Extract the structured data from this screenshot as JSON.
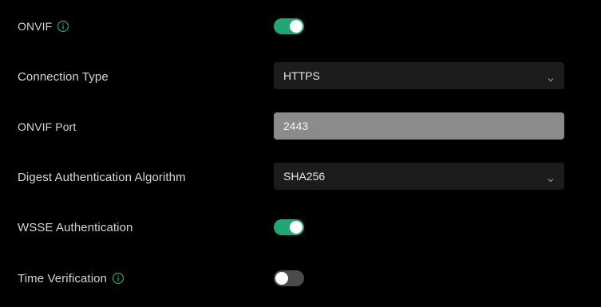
{
  "settings": {
    "onvif": {
      "label": "ONVIF",
      "enabled": true,
      "info_icon": "info-circle-icon"
    },
    "connection_type": {
      "label": "Connection Type",
      "value": "HTTPS"
    },
    "onvif_port": {
      "label": "ONVIF Port",
      "value": "2443"
    },
    "digest_algorithm": {
      "label": "Digest Authentication Algorithm",
      "value": "SHA256"
    },
    "wsse_authentication": {
      "label": "WSSE Authentication",
      "enabled": true
    },
    "time_verification": {
      "label": "Time Verification",
      "enabled": false,
      "info_icon": "info-circle-icon"
    }
  },
  "colors": {
    "background": "#000000",
    "toggle_on": "#1fa874",
    "toggle_off": "#4b4b4b",
    "select_bg": "#1c1c1c",
    "input_disabled_bg": "#8b8b8b",
    "label_text": "#d6d6d6",
    "info_icon": "#1fa874"
  }
}
